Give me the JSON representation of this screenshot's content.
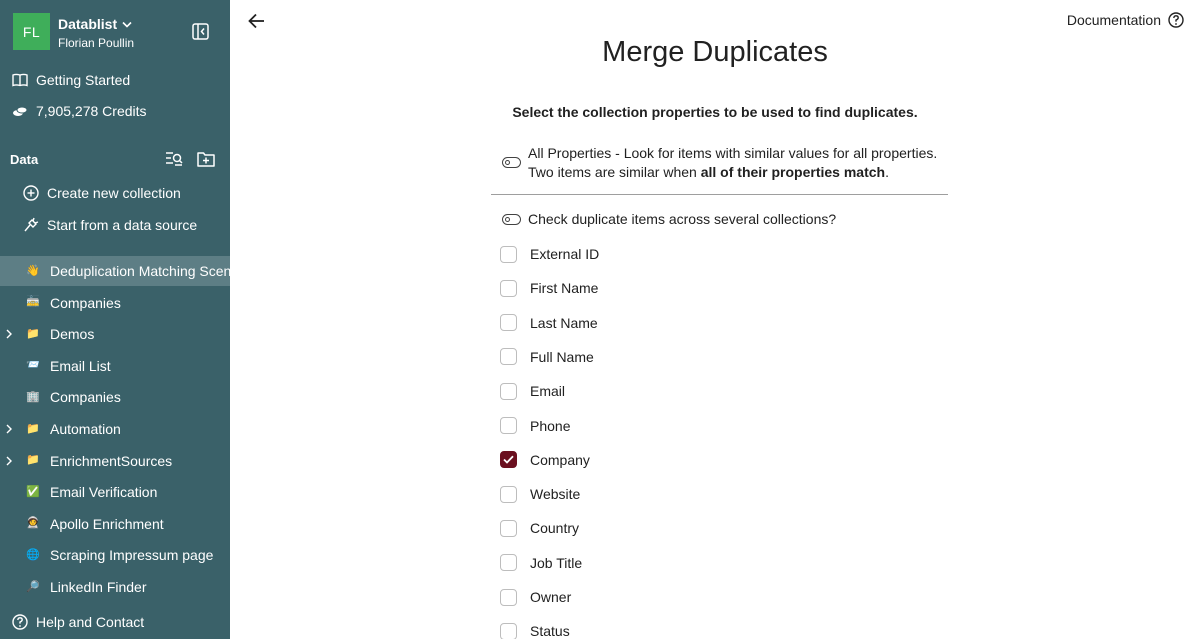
{
  "workspace": {
    "initials": "FL",
    "name": "Datablist",
    "user": "Florian Poullin"
  },
  "nav": {
    "getting_started": "Getting Started",
    "credits": "7,905,278 Credits"
  },
  "data_section": {
    "title": "Data",
    "create": "Create new collection",
    "start_source": "Start from a data source"
  },
  "collections": [
    {
      "label": "Deduplication Matching Scenario",
      "emoji": "👋",
      "expandable": false,
      "active": true
    },
    {
      "label": "Companies",
      "emoji": "🚋",
      "expandable": false,
      "active": false
    },
    {
      "label": "Demos",
      "emoji": "📁",
      "expandable": true,
      "active": false
    },
    {
      "label": "Email List",
      "emoji": "📨",
      "expandable": false,
      "active": false
    },
    {
      "label": "Companies",
      "emoji": "🏢",
      "expandable": false,
      "active": false
    },
    {
      "label": "Automation",
      "emoji": "📁",
      "expandable": true,
      "active": false
    },
    {
      "label": "EnrichmentSources",
      "emoji": "📁",
      "expandable": true,
      "active": false
    },
    {
      "label": "Email Verification",
      "emoji": "✅",
      "expandable": false,
      "active": false
    },
    {
      "label": "Apollo Enrichment",
      "emoji": "🧑‍🚀",
      "expandable": false,
      "active": false
    },
    {
      "label": "Scraping Impressum page",
      "emoji": "🌐",
      "expandable": false,
      "active": false
    },
    {
      "label": "LinkedIn Finder",
      "emoji": "🔎",
      "expandable": false,
      "active": false
    }
  ],
  "footer": {
    "help": "Help and Contact"
  },
  "header": {
    "documentation": "Documentation"
  },
  "main": {
    "title": "Merge Duplicates",
    "subtitle": "Select the collection properties to be used to find duplicates.",
    "all_props_text": "All Properties - Look for items with similar values for all properties. Two items are similar when ",
    "all_props_bold": "all of their properties match",
    "all_props_end": ".",
    "cross_collections": "Check duplicate items across several collections?"
  },
  "properties": [
    {
      "label": "External ID",
      "checked": false
    },
    {
      "label": "First Name",
      "checked": false
    },
    {
      "label": "Last Name",
      "checked": false
    },
    {
      "label": "Full Name",
      "checked": false
    },
    {
      "label": "Email",
      "checked": false
    },
    {
      "label": "Phone",
      "checked": false
    },
    {
      "label": "Company",
      "checked": true
    },
    {
      "label": "Website",
      "checked": false
    },
    {
      "label": "Country",
      "checked": false
    },
    {
      "label": "Job Title",
      "checked": false
    },
    {
      "label": "Owner",
      "checked": false
    },
    {
      "label": "Status",
      "checked": false
    }
  ],
  "colors": {
    "sidebar_bg": "#3a6169",
    "active_row": "#5d7e85",
    "avatar": "#3fae5a",
    "checkbox_checked": "#6b1020"
  }
}
